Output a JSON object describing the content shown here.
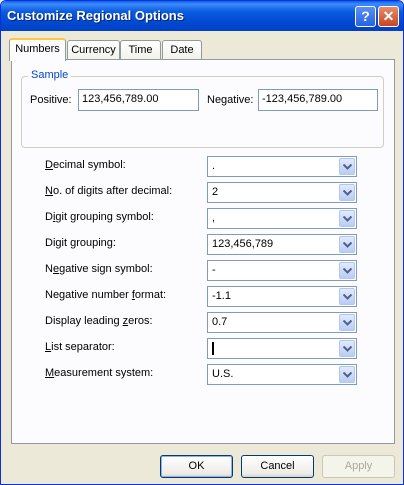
{
  "window": {
    "title": "Customize Regional Options"
  },
  "tabs": [
    {
      "label": "Numbers",
      "active": true
    },
    {
      "label": "Currency",
      "active": false
    },
    {
      "label": "Time",
      "active": false
    },
    {
      "label": "Date",
      "active": false
    }
  ],
  "sample": {
    "group_label": "Sample",
    "positive_label": "Positive:",
    "positive_value": "123,456,789.00",
    "negative_label": "Negative:",
    "negative_value": "-123,456,789.00"
  },
  "settings": [
    {
      "label": "Decimal symbol:",
      "value": "."
    },
    {
      "label": "No. of digits after decimal:",
      "value": "2"
    },
    {
      "label": "Digit grouping symbol:",
      "value": ","
    },
    {
      "label": "Digit grouping:",
      "value": "123,456,789"
    },
    {
      "label": "Negative sign symbol:",
      "value": "-"
    },
    {
      "label": "Negative number format:",
      "value": "-1.1"
    },
    {
      "label": "Display leading zeros:",
      "value": "0.7"
    },
    {
      "label": "List separator:",
      "value": ""
    },
    {
      "label": "Measurement system:",
      "value": "U.S."
    }
  ],
  "buttons": {
    "ok": "OK",
    "cancel": "Cancel",
    "apply": "Apply"
  },
  "colors": {
    "title_bar": "#0054E3",
    "face": "#ECE9D8",
    "group_label": "#0046D5",
    "active_tab_accent": "#FFC83C"
  },
  "icons": {
    "help": "help-icon",
    "close": "close-icon",
    "dropdown": "chevron-down-icon"
  }
}
